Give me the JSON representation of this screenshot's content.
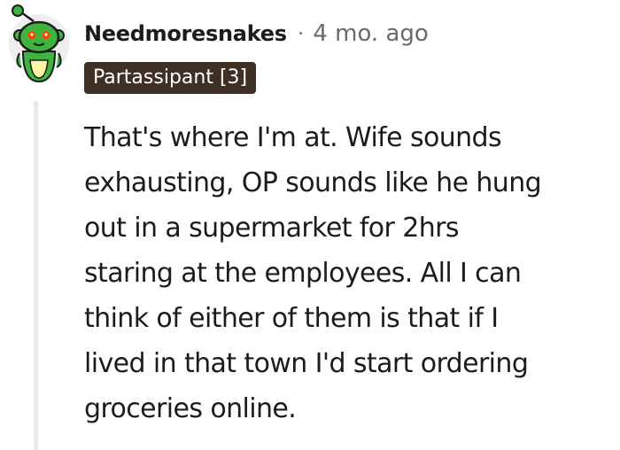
{
  "comment": {
    "author": "Needmoresnakes",
    "separator": "·",
    "timestamp": "4 mo. ago",
    "flair": "Partassipant [3]",
    "body_lines": [
      "That's where I'm at. Wife sounds",
      "exhausting, OP sounds like he hung",
      "out in a supermarket for 2hrs",
      "staring at the employees. All I can",
      "think of either of them is that if I",
      "lived in that town I'd start ordering",
      "groceries online."
    ],
    "avatar_icon": "snoo-avatar-icon",
    "colors": {
      "flair_background": "#3f2f24",
      "avatar_green": "#3fb53f",
      "thread_line": "#e9e9e9"
    }
  }
}
